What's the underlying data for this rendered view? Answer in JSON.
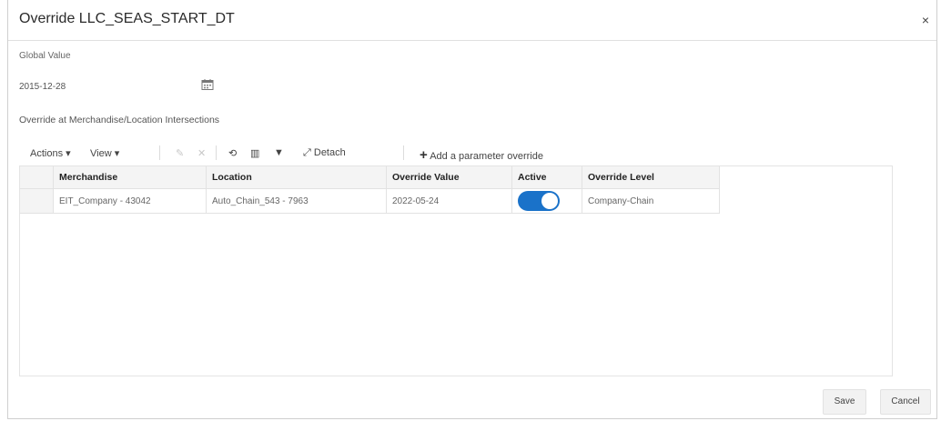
{
  "dialog": {
    "title": "Override LLC_SEAS_START_DT",
    "close_glyph": "×"
  },
  "global": {
    "label": "Global Value",
    "value": "2015-12-28",
    "calendar_icon": "calendar-icon"
  },
  "section_label": "Override at Merchandise/Location Intersections",
  "toolbar": {
    "actions": "Actions ▾",
    "view": "View ▾",
    "edit_glyph": "✎",
    "delete_glyph": "✕",
    "refresh_glyph": "⟲",
    "columns_glyph": "▥",
    "filter_glyph": "▼",
    "detach_glyph": "⤢",
    "detach": "Detach",
    "add_glyph": "+",
    "add": "Add a parameter override"
  },
  "grid": {
    "columns": [
      "Merchandise",
      "Location",
      "Override Value",
      "Active",
      "Override Level"
    ],
    "rows": [
      {
        "merchandise": "EIT_Company - 43042",
        "location": "Auto_Chain_543 - 7963",
        "override_value": "2022-05-24",
        "active": true,
        "override_level": "Company-Chain"
      }
    ]
  },
  "footer": {
    "save": "Save",
    "cancel": "Cancel"
  },
  "colors": {
    "toggle_on": "#1a72c9"
  }
}
